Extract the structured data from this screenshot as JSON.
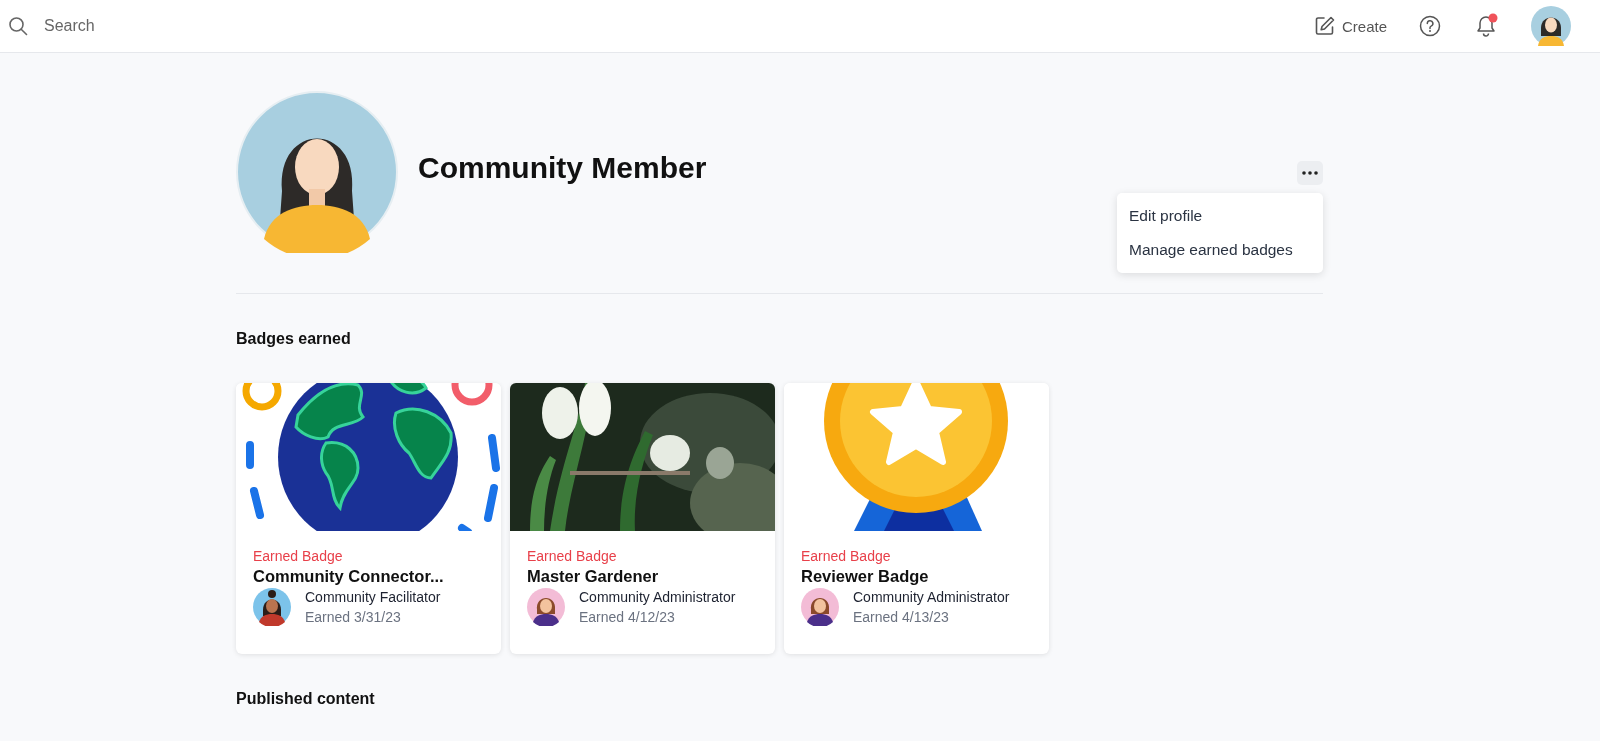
{
  "top_bar": {
    "search": {
      "placeholder": "Search"
    },
    "create_label": "Create",
    "notifications_unread": true
  },
  "profile": {
    "name": "Community Member",
    "menu": {
      "expanded": true,
      "items": [
        "Edit profile",
        "Manage earned badges"
      ]
    }
  },
  "badges_section": {
    "title": "Badges earned",
    "cards": [
      {
        "label": "Earned Badge",
        "title": "Community Connector...",
        "issuer": "Community Facilitator",
        "earned": "Earned 3/31/23"
      },
      {
        "label": "Earned Badge",
        "title": "Master Gardener",
        "issuer": "Community Administrator",
        "earned": "Earned 4/12/23"
      },
      {
        "label": "Earned Badge",
        "title": "Reviewer Badge",
        "issuer": "Community Administrator",
        "earned": "Earned 4/13/23"
      }
    ]
  },
  "published_section": {
    "title": "Published content"
  }
}
